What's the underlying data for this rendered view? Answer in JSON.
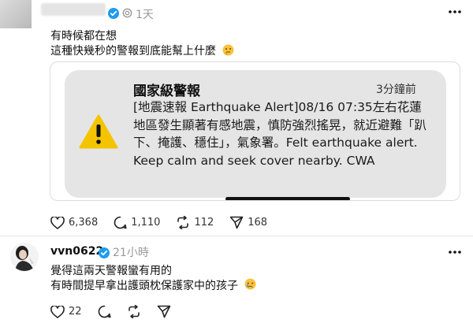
{
  "post1": {
    "time": "1天",
    "lines": [
      "有時候都在想",
      "這種快幾秒的警報到底能幫上什麼"
    ],
    "emoji": "thinking-face",
    "alert": {
      "title": "國家級警報",
      "time": "3分鐘前",
      "body": "[地震速報 Earthquake Alert]08/16 07:35左右花蓮地區發生顯著有感地震，慎防強烈搖晃，就近避難「趴下、掩護、穩住」，氣象署。Felt earthquake alert. Keep calm and seek cover nearby. CWA"
    },
    "stats": {
      "likes": "6,368",
      "comments": "1,110",
      "reposts": "112",
      "shares": "168"
    }
  },
  "post2": {
    "author": "vvn0622",
    "time": "21小時",
    "lines": [
      "覺得這兩天警報蠻有用的",
      "有時間提早拿出護頭枕保護家中的孩子"
    ],
    "emoji": "crying-face",
    "stats": {
      "likes": "22"
    }
  },
  "colors": {
    "verified": "#1d9bf0",
    "alert_bg": "#e5e5e5",
    "warning_yellow": "#f4c400"
  }
}
